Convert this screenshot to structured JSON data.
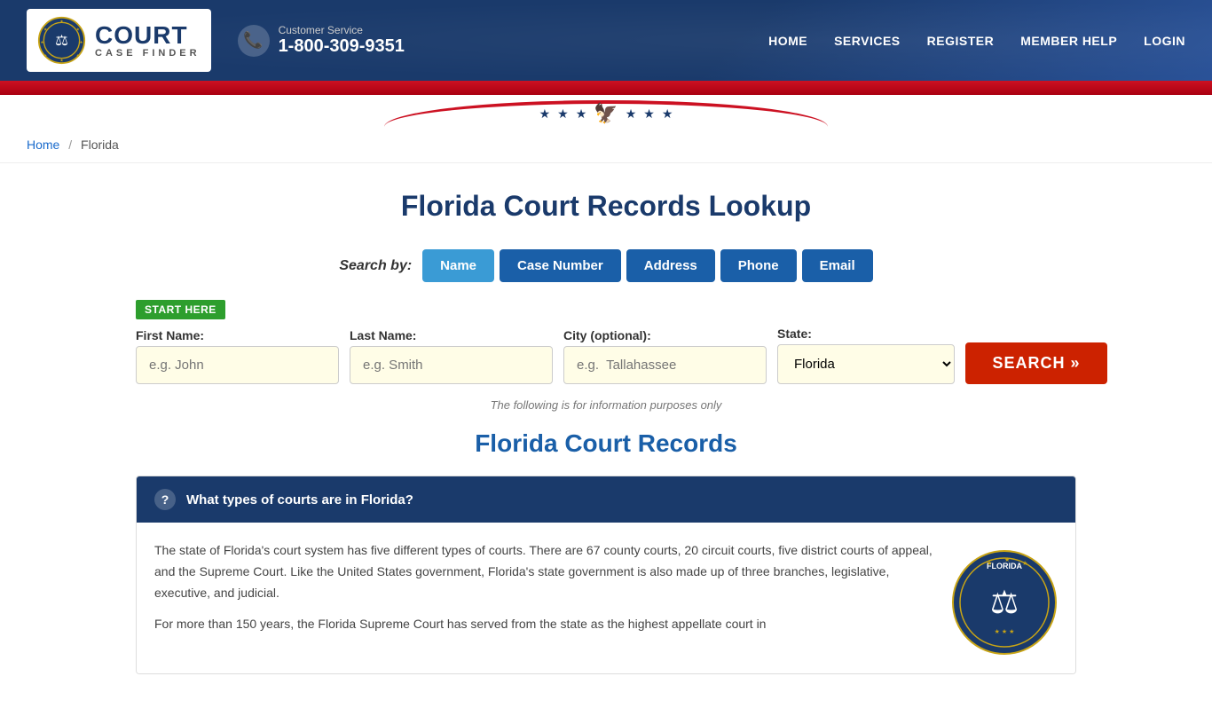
{
  "header": {
    "logo_court": "COURT",
    "logo_case_finder": "CASE FINDER",
    "cs_label": "Customer Service",
    "cs_phone": "1-800-309-9351",
    "nav": [
      {
        "label": "HOME",
        "url": "#"
      },
      {
        "label": "SERVICES",
        "url": "#"
      },
      {
        "label": "REGISTER",
        "url": "#"
      },
      {
        "label": "MEMBER HELP",
        "url": "#"
      },
      {
        "label": "LOGIN",
        "url": "#"
      }
    ]
  },
  "breadcrumb": {
    "home": "Home",
    "current": "Florida"
  },
  "page": {
    "title": "Florida Court Records Lookup",
    "search_by_label": "Search by:",
    "search_tabs": [
      {
        "label": "Name",
        "active": true
      },
      {
        "label": "Case Number",
        "active": false
      },
      {
        "label": "Address",
        "active": false
      },
      {
        "label": "Phone",
        "active": false
      },
      {
        "label": "Email",
        "active": false
      }
    ],
    "start_here": "START HERE",
    "form": {
      "first_name_label": "First Name:",
      "first_name_placeholder": "e.g. John",
      "last_name_label": "Last Name:",
      "last_name_placeholder": "e.g. Smith",
      "city_label": "City (optional):",
      "city_placeholder": "e.g.  Tallahassee",
      "state_label": "State:",
      "state_value": "Florida",
      "search_button": "SEARCH »"
    },
    "info_note": "The following is for information purposes only",
    "section_title": "Florida Court Records",
    "faq": {
      "question": "What types of courts are in Florida?",
      "body_p1": "The state of Florida's court system has five different types of courts. There are 67 county courts, 20 circuit courts, five district courts of appeal, and the Supreme Court. Like the United States government, Florida's state government is also made up of three branches, legislative, executive, and judicial.",
      "body_p2": "For more than 150 years, the Florida Supreme Court has served from the state as the highest appellate court in"
    }
  }
}
